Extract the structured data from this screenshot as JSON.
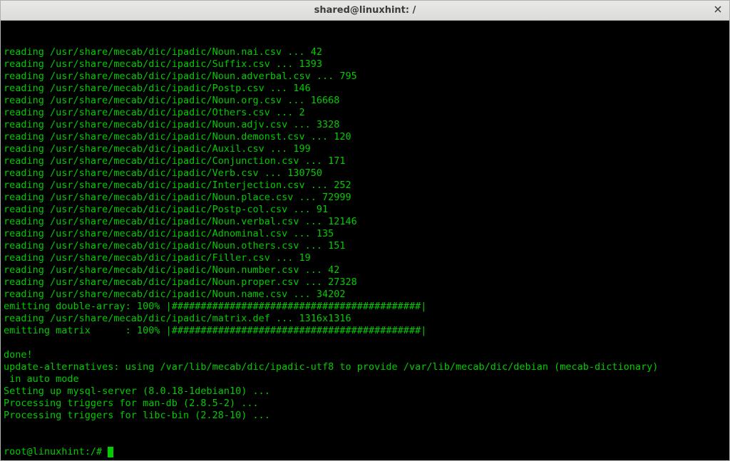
{
  "window": {
    "title": "shared@linuxhint: /"
  },
  "terminal": {
    "lines": [
      "reading /usr/share/mecab/dic/ipadic/Noun.nai.csv ... 42",
      "reading /usr/share/mecab/dic/ipadic/Suffix.csv ... 1393",
      "reading /usr/share/mecab/dic/ipadic/Noun.adverbal.csv ... 795",
      "reading /usr/share/mecab/dic/ipadic/Postp.csv ... 146",
      "reading /usr/share/mecab/dic/ipadic/Noun.org.csv ... 16668",
      "reading /usr/share/mecab/dic/ipadic/Others.csv ... 2",
      "reading /usr/share/mecab/dic/ipadic/Noun.adjv.csv ... 3328",
      "reading /usr/share/mecab/dic/ipadic/Noun.demonst.csv ... 120",
      "reading /usr/share/mecab/dic/ipadic/Auxil.csv ... 199",
      "reading /usr/share/mecab/dic/ipadic/Conjunction.csv ... 171",
      "reading /usr/share/mecab/dic/ipadic/Verb.csv ... 130750",
      "reading /usr/share/mecab/dic/ipadic/Interjection.csv ... 252",
      "reading /usr/share/mecab/dic/ipadic/Noun.place.csv ... 72999",
      "reading /usr/share/mecab/dic/ipadic/Postp-col.csv ... 91",
      "reading /usr/share/mecab/dic/ipadic/Noun.verbal.csv ... 12146",
      "reading /usr/share/mecab/dic/ipadic/Adnominal.csv ... 135",
      "reading /usr/share/mecab/dic/ipadic/Noun.others.csv ... 151",
      "reading /usr/share/mecab/dic/ipadic/Filler.csv ... 19",
      "reading /usr/share/mecab/dic/ipadic/Noun.number.csv ... 42",
      "reading /usr/share/mecab/dic/ipadic/Noun.proper.csv ... 27328",
      "reading /usr/share/mecab/dic/ipadic/Noun.name.csv ... 34202",
      "emitting double-array: 100% |###########################################| ",
      "reading /usr/share/mecab/dic/ipadic/matrix.def ... 1316x1316",
      "emitting matrix      : 100% |###########################################| ",
      "",
      "done!",
      "update-alternatives: using /var/lib/mecab/dic/ipadic-utf8 to provide /var/lib/mecab/dic/debian (mecab-dictionary)",
      " in auto mode",
      "Setting up mysql-server (8.0.18-1debian10) ...",
      "Processing triggers for man-db (2.8.5-2) ...",
      "Processing triggers for libc-bin (2.28-10) ..."
    ],
    "prompt": "root@linuxhint:/#"
  }
}
